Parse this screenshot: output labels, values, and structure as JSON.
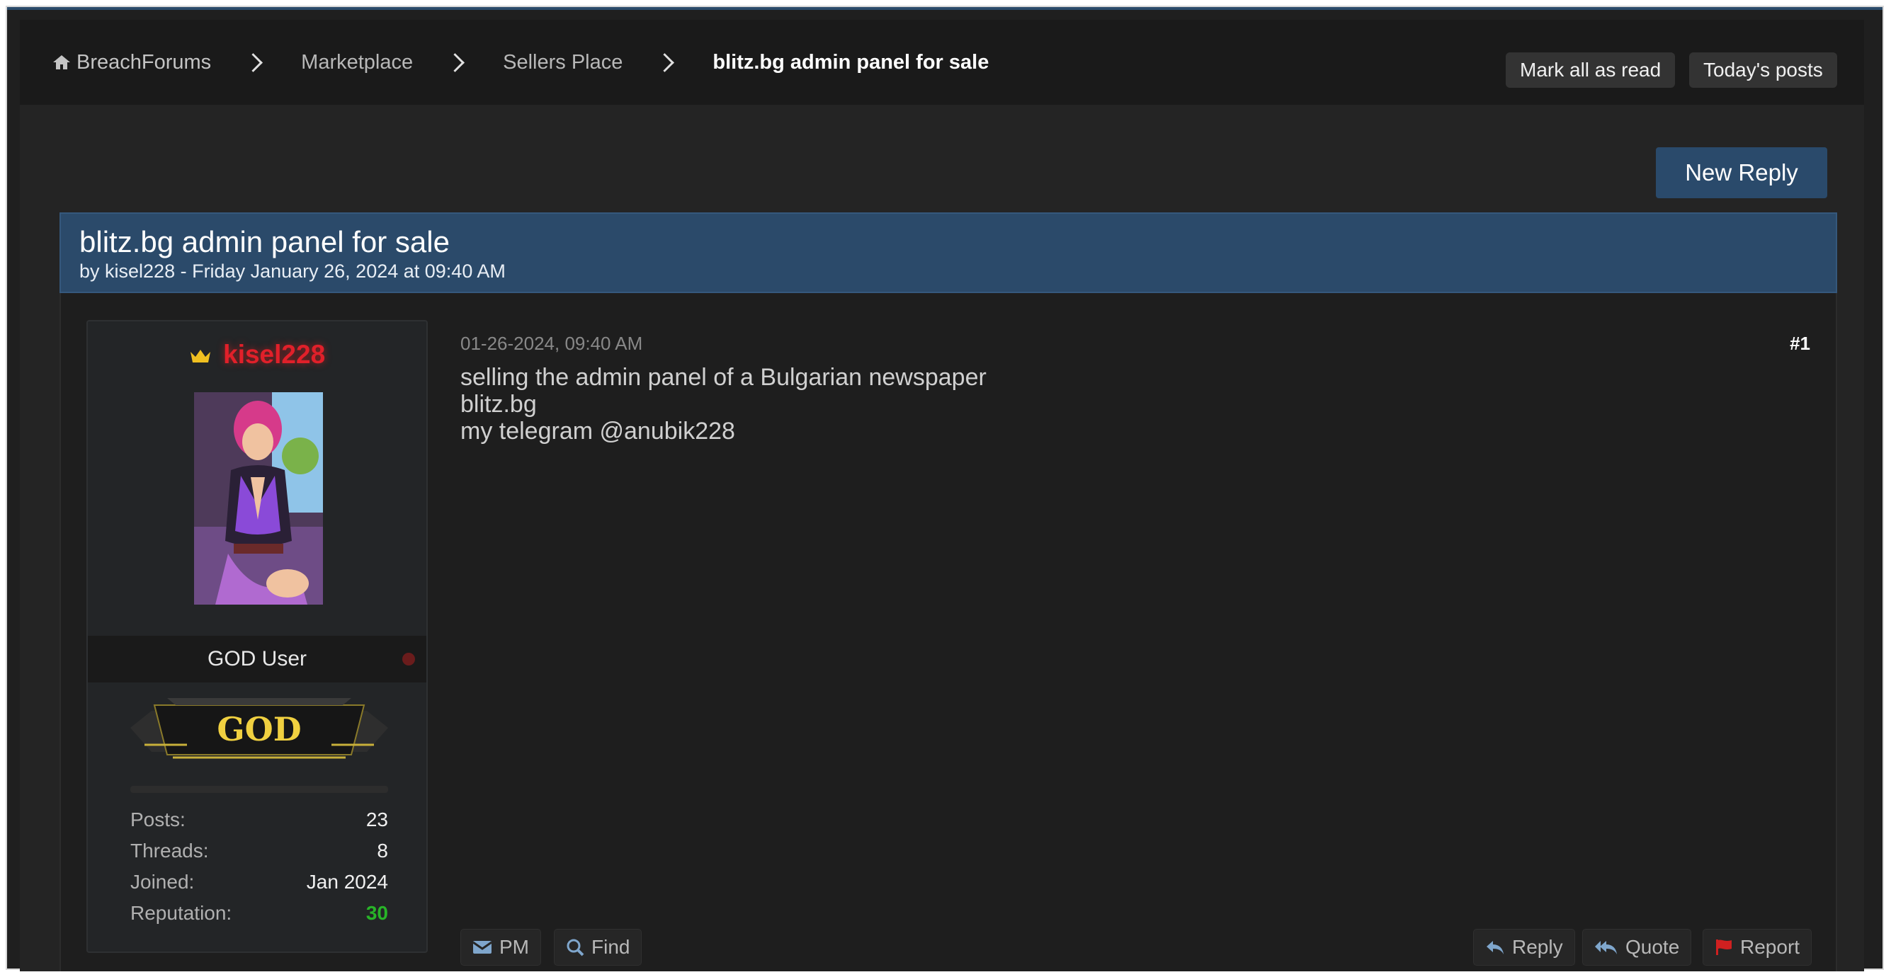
{
  "breadcrumb": {
    "home": "BreachForums",
    "items": [
      "Marketplace",
      "Sellers Place"
    ],
    "current": "blitz.bg admin panel for sale"
  },
  "header_buttons": {
    "mark_all_read": "Mark all as read",
    "todays_posts": "Today's posts"
  },
  "new_reply": "New Reply",
  "thread": {
    "title": "blitz.bg admin panel for sale",
    "subtitle": "by kisel228 - Friday January 26, 2024 at 09:40 AM"
  },
  "post": {
    "date": "01-26-2024, 09:40 AM",
    "number": "#1",
    "lines": [
      "selling the admin panel of a Bulgarian newspaper",
      "blitz.bg",
      "my telegram @anubik228"
    ],
    "actions": {
      "pm": "PM",
      "find": "Find",
      "reply": "Reply",
      "quote": "Quote",
      "report": "Report"
    }
  },
  "author": {
    "username": "kisel228",
    "rank": "GOD User",
    "badge_text": "GOD",
    "stats": [
      {
        "label": "Posts:",
        "value": "23"
      },
      {
        "label": "Threads:",
        "value": "8"
      },
      {
        "label": "Joined:",
        "value": "Jan 2024"
      },
      {
        "label": "Reputation:",
        "value": "30"
      }
    ]
  },
  "colors": {
    "accent": "#2b4a6a",
    "username": "#e0202a",
    "reputation": "#28b428",
    "crown": "#f0c020"
  },
  "icons": [
    "home-icon",
    "chevron-right-icon",
    "crown-icon",
    "envelope-icon",
    "search-icon",
    "reply-icon",
    "quote-icon",
    "flag-icon"
  ]
}
